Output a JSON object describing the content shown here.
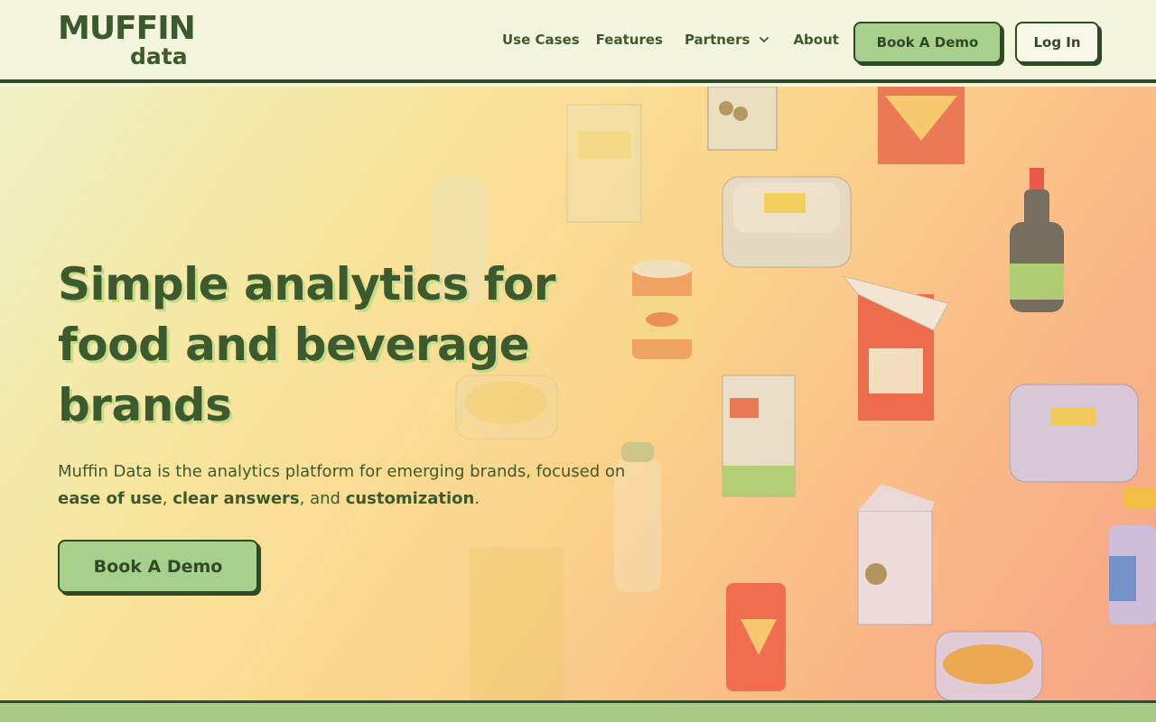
{
  "header": {
    "logo_top": "MUFFIN",
    "logo_bottom": "data",
    "nav": {
      "use_cases": "Use Cases",
      "features": "Features",
      "partners": "Partners",
      "about": "About"
    },
    "book_demo": "Book A Demo",
    "log_in": "Log In"
  },
  "hero": {
    "title": "Simple analytics for food and beverage brands",
    "subtitle_start": "Muffin Data is the analytics platform for emerging brands, focused on ",
    "ease": "ease of use",
    "comma1": ", ",
    "clear": "clear answers",
    "comma2": ", and ",
    "custom": "customization",
    "period": ".",
    "book_demo": "Book A Demo"
  },
  "colors": {
    "brand_dark_green": "#3d5a2e",
    "button_green": "#a8d08d",
    "header_bg": "#f2f4dc"
  }
}
